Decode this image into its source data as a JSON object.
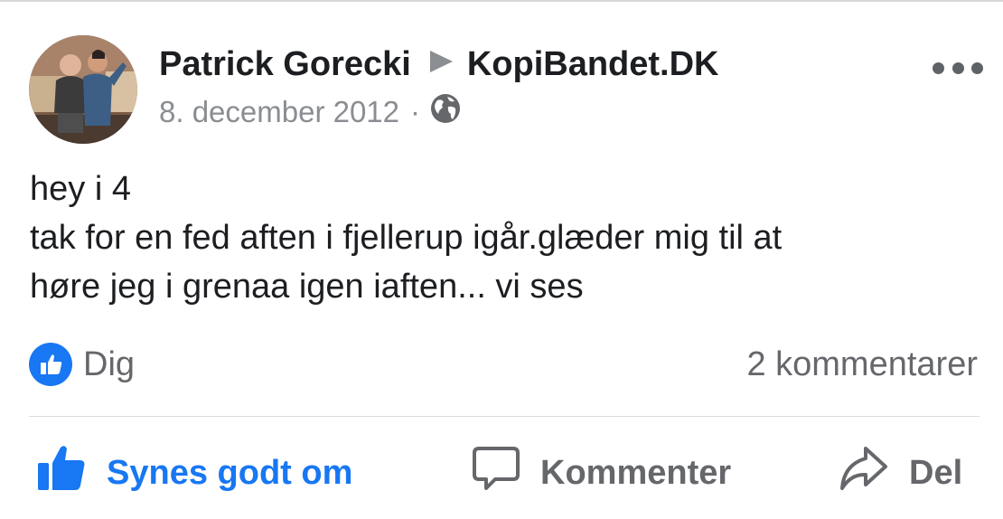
{
  "post": {
    "author": "Patrick Gorecki",
    "target": "KopiBandet.DK",
    "date": "8. december 2012",
    "separator": "·",
    "privacy_icon": "globe-icon",
    "more_icon": "more-dots-icon",
    "body_lines": [
      "hey i 4",
      "tak for en fed aften i fjellerup igår.glæder mig til at",
      "høre jeg i grenaa igen iaften... vi ses"
    ]
  },
  "reactions": {
    "icon": "like-badge-icon",
    "label": "Dig",
    "comments": "2 kommentarer"
  },
  "actions": {
    "like": "Synes godt om",
    "comment": "Kommenter",
    "share": "Del"
  },
  "colors": {
    "brand_blue": "#1877f2",
    "text": "#1c1e21",
    "secondary": "#65676b",
    "meta": "#8a8d91"
  }
}
